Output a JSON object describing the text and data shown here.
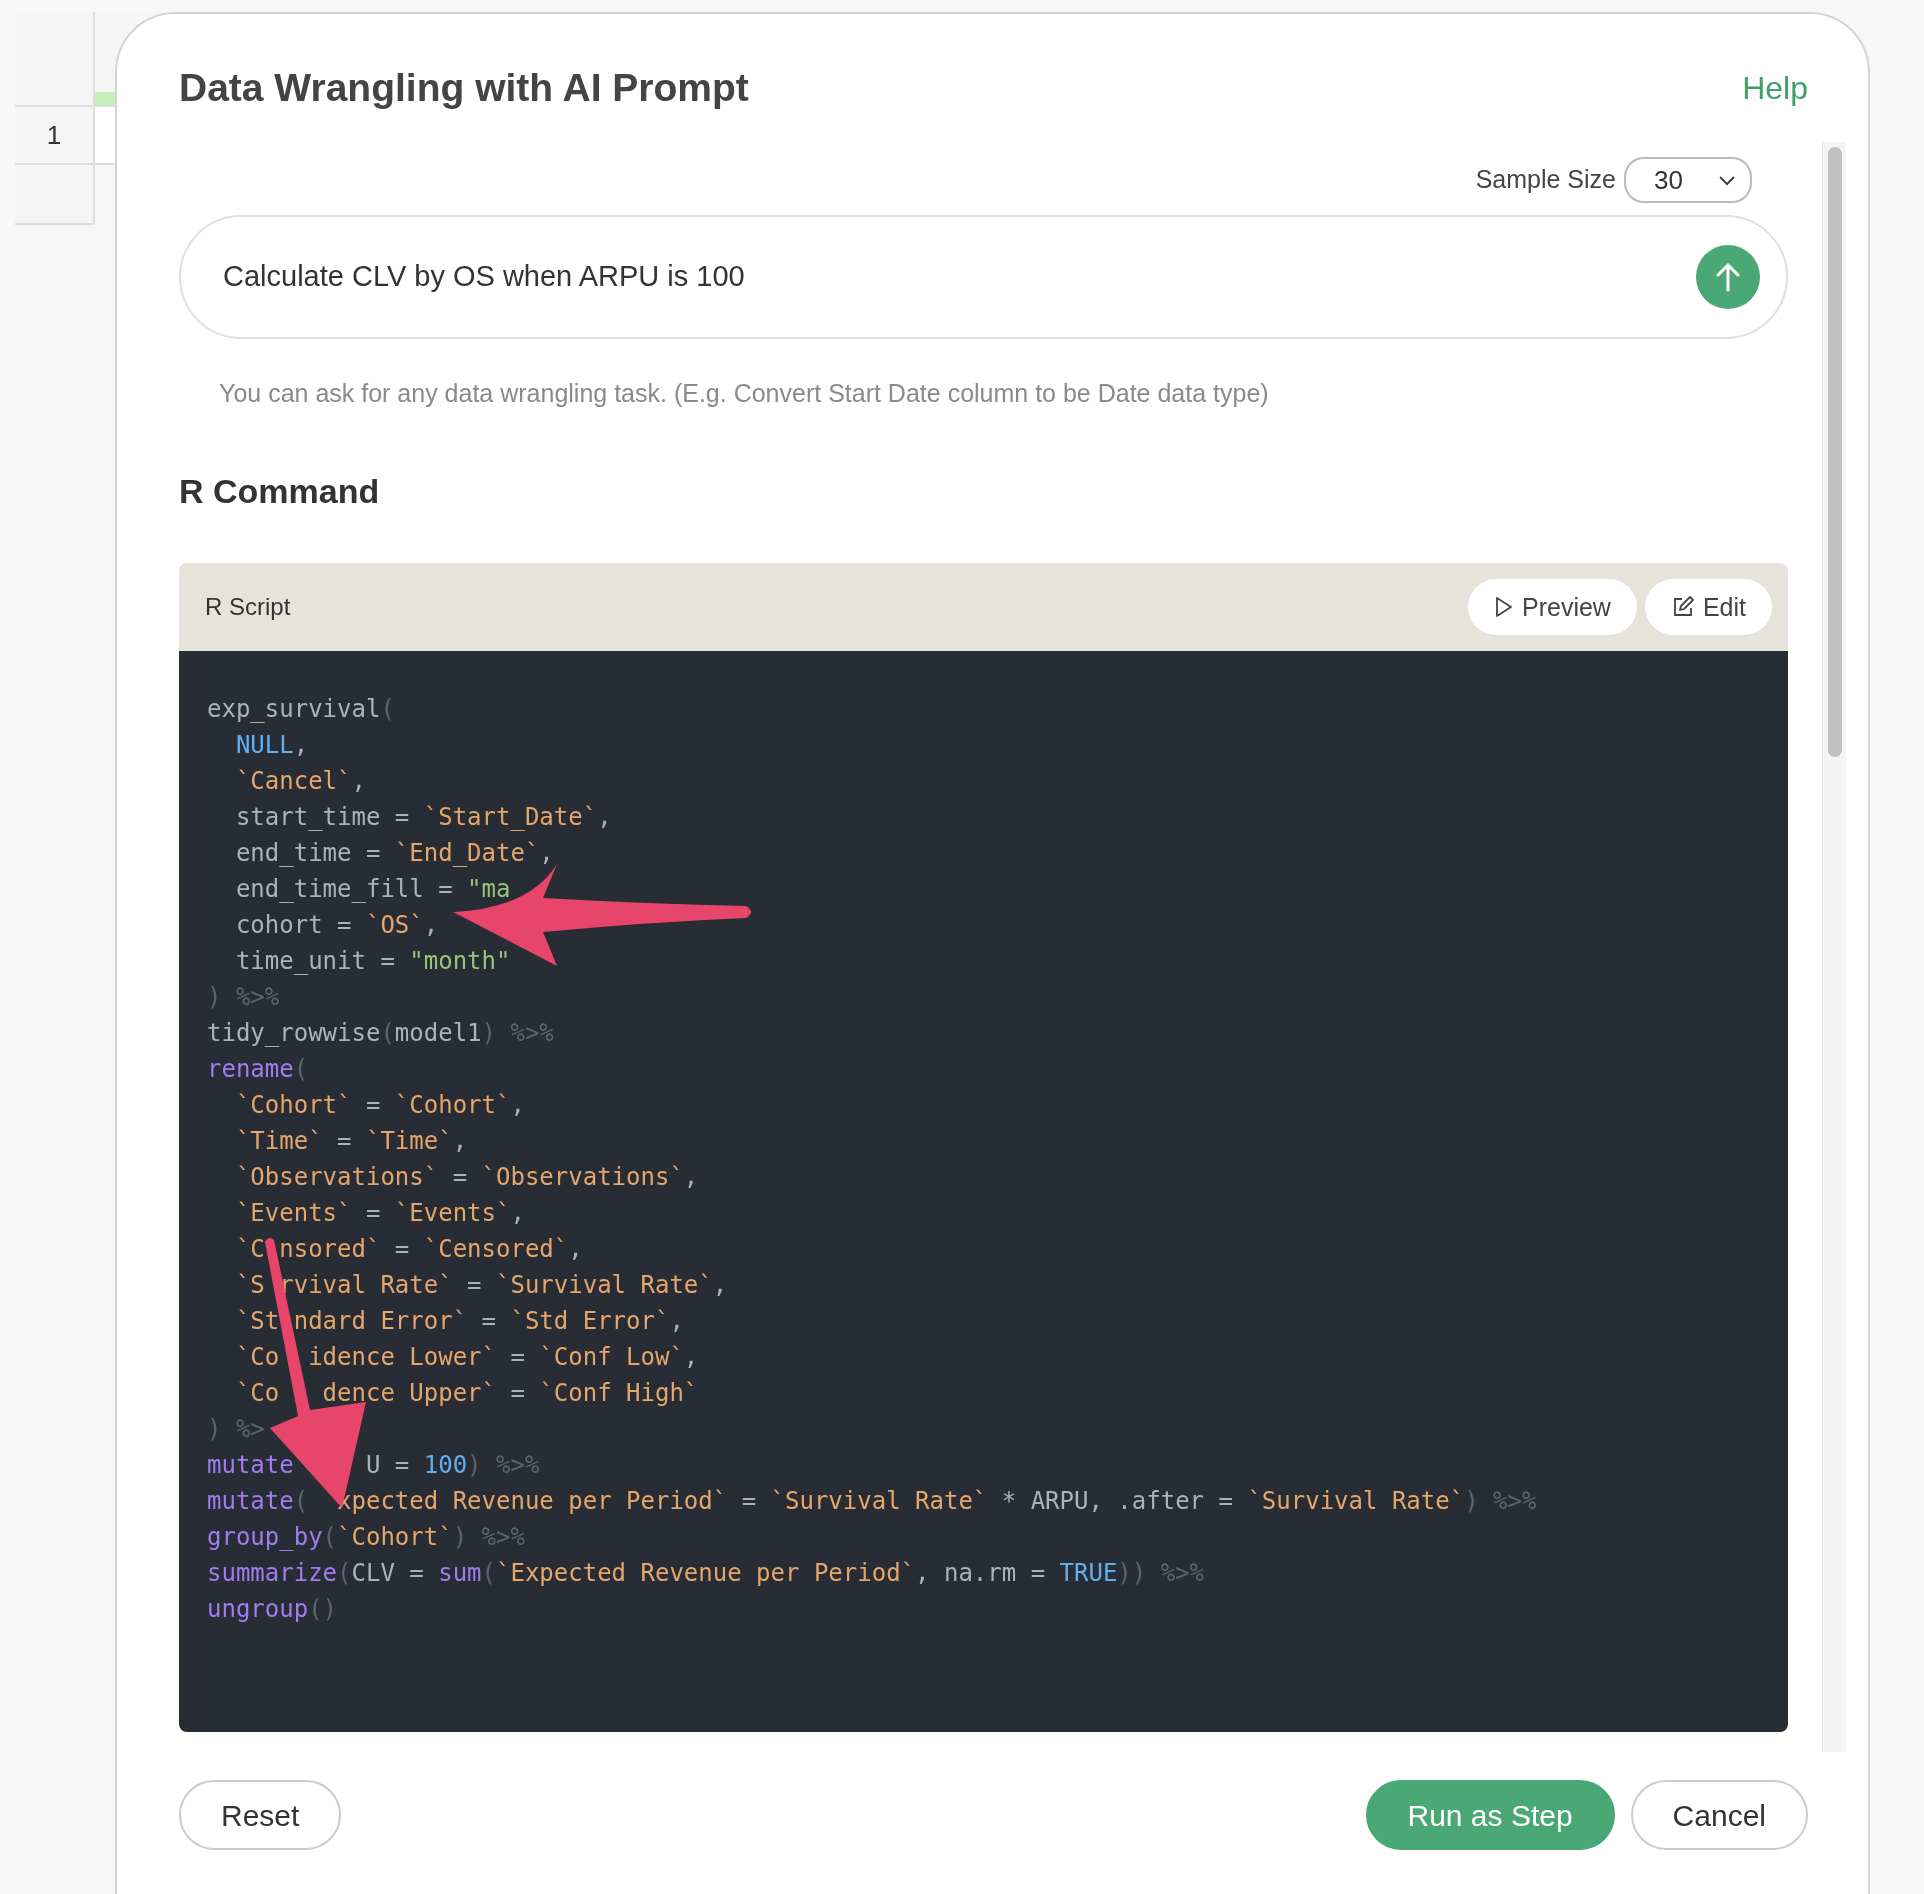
{
  "background_sheet": {
    "row_numbers": [
      "1"
    ]
  },
  "dialog": {
    "title": "Data Wrangling with AI Prompt",
    "help_link": "Help",
    "sample_size": {
      "label": "Sample Size",
      "value": "30"
    },
    "prompt": {
      "value": "Calculate CLV by OS when ARPU is 100"
    },
    "hint": "You can ask for any data wrangling task. (E.g. Convert Start Date column to be Date data type)",
    "section_title": "R Command",
    "script_panel": {
      "title": "R Script",
      "buttons": [
        {
          "label": "Preview",
          "kind": "preview"
        },
        {
          "label": "Edit",
          "kind": "edit"
        }
      ],
      "code_lines": [
        [
          {
            "kind": "plain",
            "text": "exp_survival"
          },
          {
            "kind": "punct",
            "text": "("
          }
        ],
        [
          {
            "kind": "const",
            "text": "  NULL"
          },
          {
            "kind": "plain",
            "text": ","
          }
        ],
        [
          {
            "kind": "tick",
            "text": "  `Cancel`"
          },
          {
            "kind": "plain",
            "text": ","
          }
        ],
        [
          {
            "kind": "plain",
            "text": "  start_time = "
          },
          {
            "kind": "tick",
            "text": "`Start_Date`"
          },
          {
            "kind": "plain",
            "text": ","
          }
        ],
        [
          {
            "kind": "plain",
            "text": "  end_time = "
          },
          {
            "kind": "tick",
            "text": "`End_Date`"
          },
          {
            "kind": "plain",
            "text": ","
          }
        ],
        [
          {
            "kind": "plain",
            "text": "  end_time_fill = "
          },
          {
            "kind": "string",
            "text": "\"ma"
          }
        ],
        [
          {
            "kind": "plain",
            "text": "  cohort = "
          },
          {
            "kind": "tick",
            "text": "`OS`"
          },
          {
            "kind": "plain",
            "text": ","
          }
        ],
        [
          {
            "kind": "plain",
            "text": "  time_unit = "
          },
          {
            "kind": "string",
            "text": "\"month\""
          }
        ],
        [
          {
            "kind": "punct",
            "text": ") %>%"
          }
        ],
        [
          {
            "kind": "plain",
            "text": "tidy_rowwise"
          },
          {
            "kind": "punct",
            "text": "("
          },
          {
            "kind": "plain",
            "text": "model1"
          },
          {
            "kind": "punct",
            "text": ") %>%"
          }
        ],
        [
          {
            "kind": "func",
            "text": "rename"
          },
          {
            "kind": "punct",
            "text": "("
          }
        ],
        [
          {
            "kind": "tick",
            "text": "  `Cohort`"
          },
          {
            "kind": "plain",
            "text": " = "
          },
          {
            "kind": "tick",
            "text": "`Cohort`"
          },
          {
            "kind": "plain",
            "text": ","
          }
        ],
        [
          {
            "kind": "tick",
            "text": "  `Time`"
          },
          {
            "kind": "plain",
            "text": " = "
          },
          {
            "kind": "tick",
            "text": "`Time`"
          },
          {
            "kind": "plain",
            "text": ","
          }
        ],
        [
          {
            "kind": "tick",
            "text": "  `Observations`"
          },
          {
            "kind": "plain",
            "text": " = "
          },
          {
            "kind": "tick",
            "text": "`Observations`"
          },
          {
            "kind": "plain",
            "text": ","
          }
        ],
        [
          {
            "kind": "tick",
            "text": "  `Events`"
          },
          {
            "kind": "plain",
            "text": " = "
          },
          {
            "kind": "tick",
            "text": "`Events`"
          },
          {
            "kind": "plain",
            "text": ","
          }
        ],
        [
          {
            "kind": "tick",
            "text": "  `C nsored`"
          },
          {
            "kind": "plain",
            "text": " = "
          },
          {
            "kind": "tick",
            "text": "`Censored`"
          },
          {
            "kind": "plain",
            "text": ","
          }
        ],
        [
          {
            "kind": "tick",
            "text": "  `S rvival Rate`"
          },
          {
            "kind": "plain",
            "text": " = "
          },
          {
            "kind": "tick",
            "text": "`Survival Rate`"
          },
          {
            "kind": "plain",
            "text": ","
          }
        ],
        [
          {
            "kind": "tick",
            "text": "  `St ndard Error`"
          },
          {
            "kind": "plain",
            "text": " = "
          },
          {
            "kind": "tick",
            "text": "`Std Error`"
          },
          {
            "kind": "plain",
            "text": ","
          }
        ],
        [
          {
            "kind": "tick",
            "text": "  `Co  idence Lower`"
          },
          {
            "kind": "plain",
            "text": " = "
          },
          {
            "kind": "tick",
            "text": "`Conf Low`"
          },
          {
            "kind": "plain",
            "text": ","
          }
        ],
        [
          {
            "kind": "tick",
            "text": "  `Co   dence Upper`"
          },
          {
            "kind": "plain",
            "text": " = "
          },
          {
            "kind": "tick",
            "text": "`Conf High`"
          }
        ],
        [
          {
            "kind": "punct",
            "text": ") %>"
          }
        ],
        [
          {
            "kind": "func",
            "text": "mutate"
          },
          {
            "kind": "plain",
            "text": "     U = "
          },
          {
            "kind": "const",
            "text": "100"
          },
          {
            "kind": "punct",
            "text": ") %>%"
          }
        ],
        [
          {
            "kind": "func",
            "text": "mutate"
          },
          {
            "kind": "punct",
            "text": "("
          },
          {
            "kind": "tick",
            "text": "  xpected Revenue per Period`"
          },
          {
            "kind": "plain",
            "text": " = "
          },
          {
            "kind": "tick",
            "text": "`Survival Rate`"
          },
          {
            "kind": "plain",
            "text": " * ARPU, .after = "
          },
          {
            "kind": "tick",
            "text": "`Survival Rate`"
          },
          {
            "kind": "punct",
            "text": ") %>%"
          }
        ],
        [
          {
            "kind": "func",
            "text": "group_by"
          },
          {
            "kind": "punct",
            "text": "("
          },
          {
            "kind": "tick",
            "text": "`Cohort`"
          },
          {
            "kind": "punct",
            "text": ") %>%"
          }
        ],
        [
          {
            "kind": "func",
            "text": "summarize"
          },
          {
            "kind": "punct",
            "text": "("
          },
          {
            "kind": "plain",
            "text": "CLV = "
          },
          {
            "kind": "func",
            "text": "sum"
          },
          {
            "kind": "punct",
            "text": "("
          },
          {
            "kind": "tick",
            "text": "`Expected Revenue per Period`"
          },
          {
            "kind": "plain",
            "text": ", na.rm = "
          },
          {
            "kind": "const",
            "text": "TRUE"
          },
          {
            "kind": "punct",
            "text": ")) %>%"
          }
        ],
        [
          {
            "kind": "func",
            "text": "ungroup"
          },
          {
            "kind": "punct",
            "text": "()"
          }
        ]
      ]
    },
    "footer_buttons": [
      {
        "label": "Reset",
        "kind": "reset"
      },
      {
        "label": "Run as Step",
        "kind": "primary"
      },
      {
        "label": "Cancel",
        "kind": "secondary"
      }
    ]
  }
}
